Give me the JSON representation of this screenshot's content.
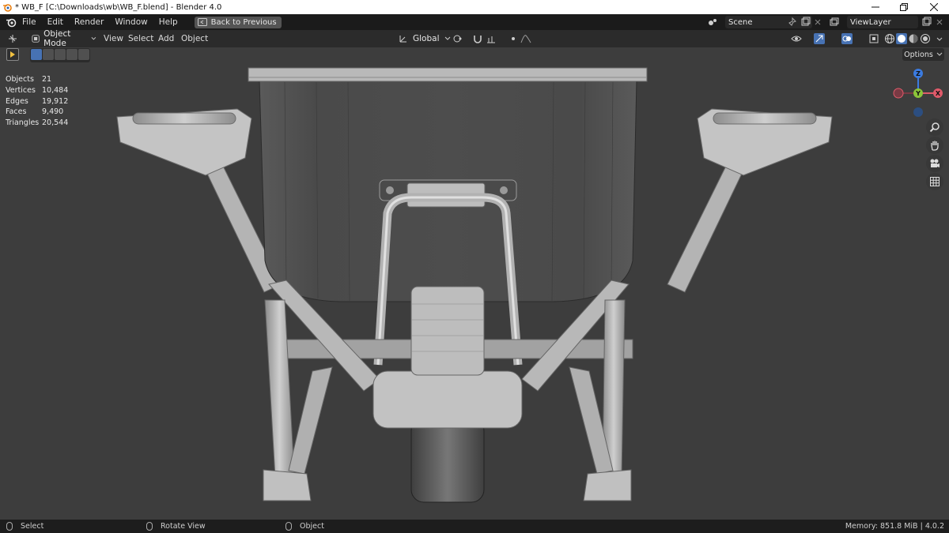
{
  "window": {
    "title": "* WB_F [C:\\Downloads\\wb\\WB_F.blend] - Blender 4.0"
  },
  "menubar": {
    "items": [
      "File",
      "Edit",
      "Render",
      "Window",
      "Help"
    ],
    "back_button": "Back to Previous",
    "scene": "Scene",
    "view_layer": "ViewLayer"
  },
  "viewport_header": {
    "mode": "Object Mode",
    "menus": [
      "View",
      "Select",
      "Add",
      "Object"
    ],
    "orientation": "Global"
  },
  "stats": [
    {
      "label": "Objects",
      "value": "21"
    },
    {
      "label": "Vertices",
      "value": "10,484"
    },
    {
      "label": "Edges",
      "value": "19,912"
    },
    {
      "label": "Faces",
      "value": "9,490"
    },
    {
      "label": "Triangles",
      "value": "20,544"
    }
  ],
  "options_label": "Options",
  "gizmo": {
    "z": "Z",
    "y": "Y",
    "x": "X"
  },
  "statusbar": {
    "select": "Select",
    "rotate": "Rotate View",
    "object": "Object",
    "memory": "Memory: 851.8 MiB | 4.0.2"
  },
  "colors": {
    "x_axis": "#e05a6a",
    "y_axis": "#8cc43a",
    "z_axis": "#3b7be0",
    "accent": "#4772b3"
  }
}
